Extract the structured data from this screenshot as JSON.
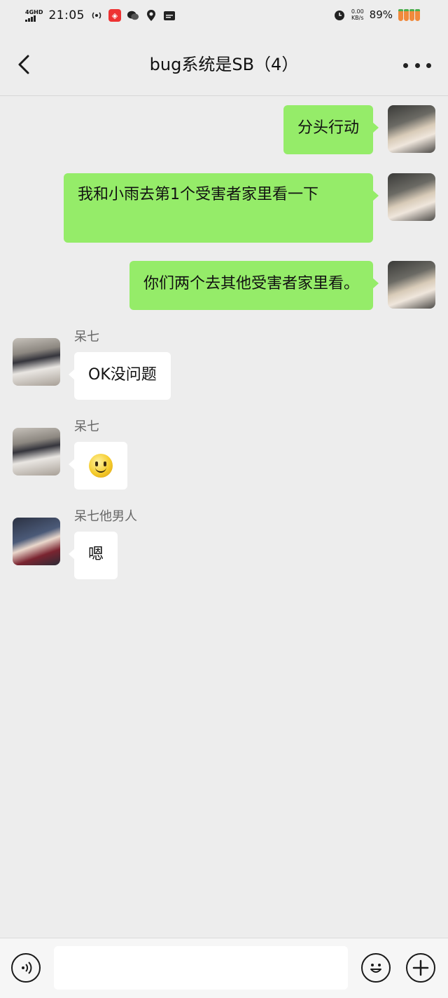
{
  "status_bar": {
    "network": "4GHD",
    "time": "21:05",
    "net_speed_value": "0.00",
    "net_speed_unit": "KB/s",
    "battery": "89%"
  },
  "header": {
    "title": "bug系统是SB（4）"
  },
  "messages": [
    {
      "direction": "out",
      "text": "分头行动"
    },
    {
      "direction": "out",
      "text": "我和小雨去第1个受害者家里看一下"
    },
    {
      "direction": "out",
      "text": "你们两个去其他受害者家里看。"
    },
    {
      "direction": "in",
      "sender": "呆七",
      "text": "OK没问题"
    },
    {
      "direction": "in",
      "sender": "呆七",
      "emoji": "smiley"
    },
    {
      "direction": "in",
      "sender": "呆七他男人",
      "text": "嗯"
    }
  ],
  "input_bar": {
    "text_value": ""
  }
}
